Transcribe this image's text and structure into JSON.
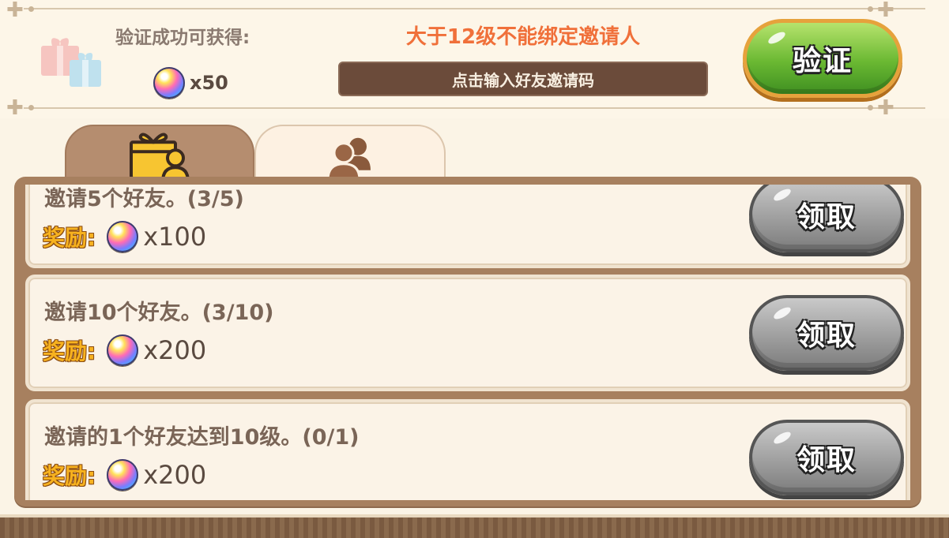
{
  "header": {
    "reward_label": "验证成功可获得:",
    "reward_amount": "x50",
    "warning": "大于12级不能绑定邀请人",
    "code_placeholder": "点击输入好友邀请码",
    "verify_label": "验证"
  },
  "tabs": [
    {
      "name": "gift-rewards-tab",
      "icon": "gift-person-icon",
      "active": true
    },
    {
      "name": "friends-tab",
      "icon": "friends-icon",
      "active": false
    }
  ],
  "tasks": [
    {
      "title": "邀请5个好友。(3/5)",
      "reward_tag": "奖励:",
      "reward_amount": "x100",
      "claim_label": "领取"
    },
    {
      "title": "邀请10个好友。(3/10)",
      "reward_tag": "奖励:",
      "reward_amount": "x200",
      "claim_label": "领取"
    },
    {
      "title": "邀请的1个好友达到10级。(0/1)",
      "reward_tag": "奖励:",
      "reward_amount": "x200",
      "claim_label": "领取"
    }
  ],
  "colors": {
    "warning": "#f0703a",
    "verify_button": "#6ab832",
    "claim_button": "#9f9f9f",
    "reward_tag": "#f7b21f"
  }
}
